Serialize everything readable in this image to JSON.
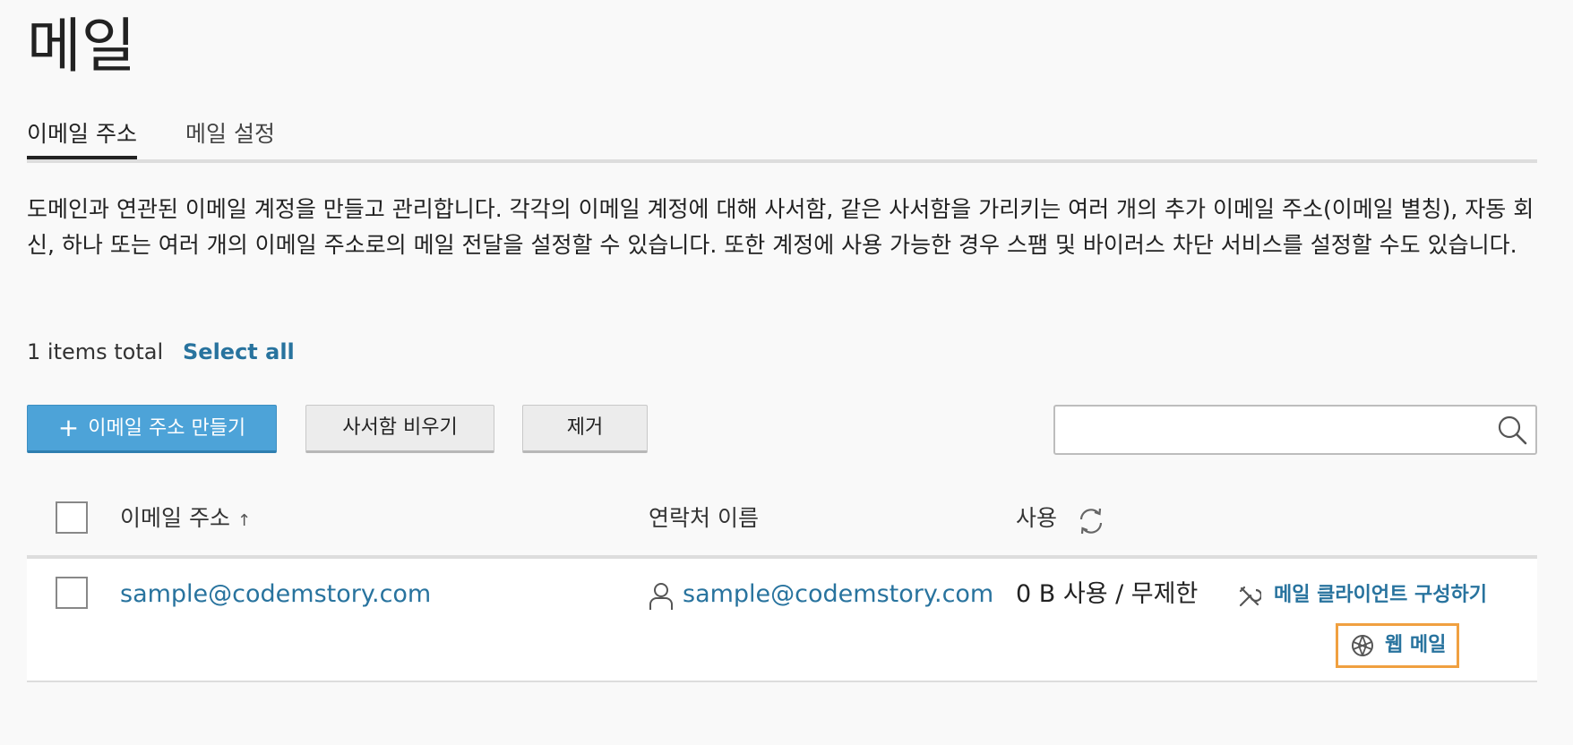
{
  "page": {
    "title": "메일"
  },
  "tabs": [
    {
      "label": "이메일 주소",
      "active": true
    },
    {
      "label": "메일 설정",
      "active": false
    }
  ],
  "description": "도메인과 연관된 이메일 계정을 만들고 관리합니다. 각각의 이메일 계정에 대해 사서함, 같은 사서함을 가리키는 여러 개의 추가 이메일 주소(이메일 별칭), 자동 회신, 하나 또는 여러 개의 이메일 주소로의 메일 전달을 설정할 수 있습니다. 또한 계정에 사용 가능한 경우 스팸 및 바이러스 차단 서비스를 설정할 수도 있습니다.",
  "list_summary": {
    "count_text": "1 items total",
    "select_all": "Select all"
  },
  "toolbar": {
    "create_label": "이메일 주소 만들기",
    "create_icon": "+",
    "empty_label": "사서함 비우기",
    "remove_label": "제거"
  },
  "search": {
    "value": "",
    "placeholder": "",
    "icon": "search-icon"
  },
  "table": {
    "columns": {
      "email": "이메일 주소",
      "email_sort": "↑",
      "contact": "연락처 이름",
      "usage": "사용"
    },
    "rows": [
      {
        "email": "sample@codemstory.com",
        "contact": "sample@codemstory.com",
        "usage": "0 B 사용 / 무제한",
        "actions": {
          "configure_client": "메일 클라이언트 구성하기",
          "webmail": "웹 메일"
        }
      }
    ]
  },
  "colors": {
    "link": "#28739e",
    "primary_button": "#4da3d8",
    "focus_outline": "#f0a040",
    "background": "#f9f9f9"
  }
}
